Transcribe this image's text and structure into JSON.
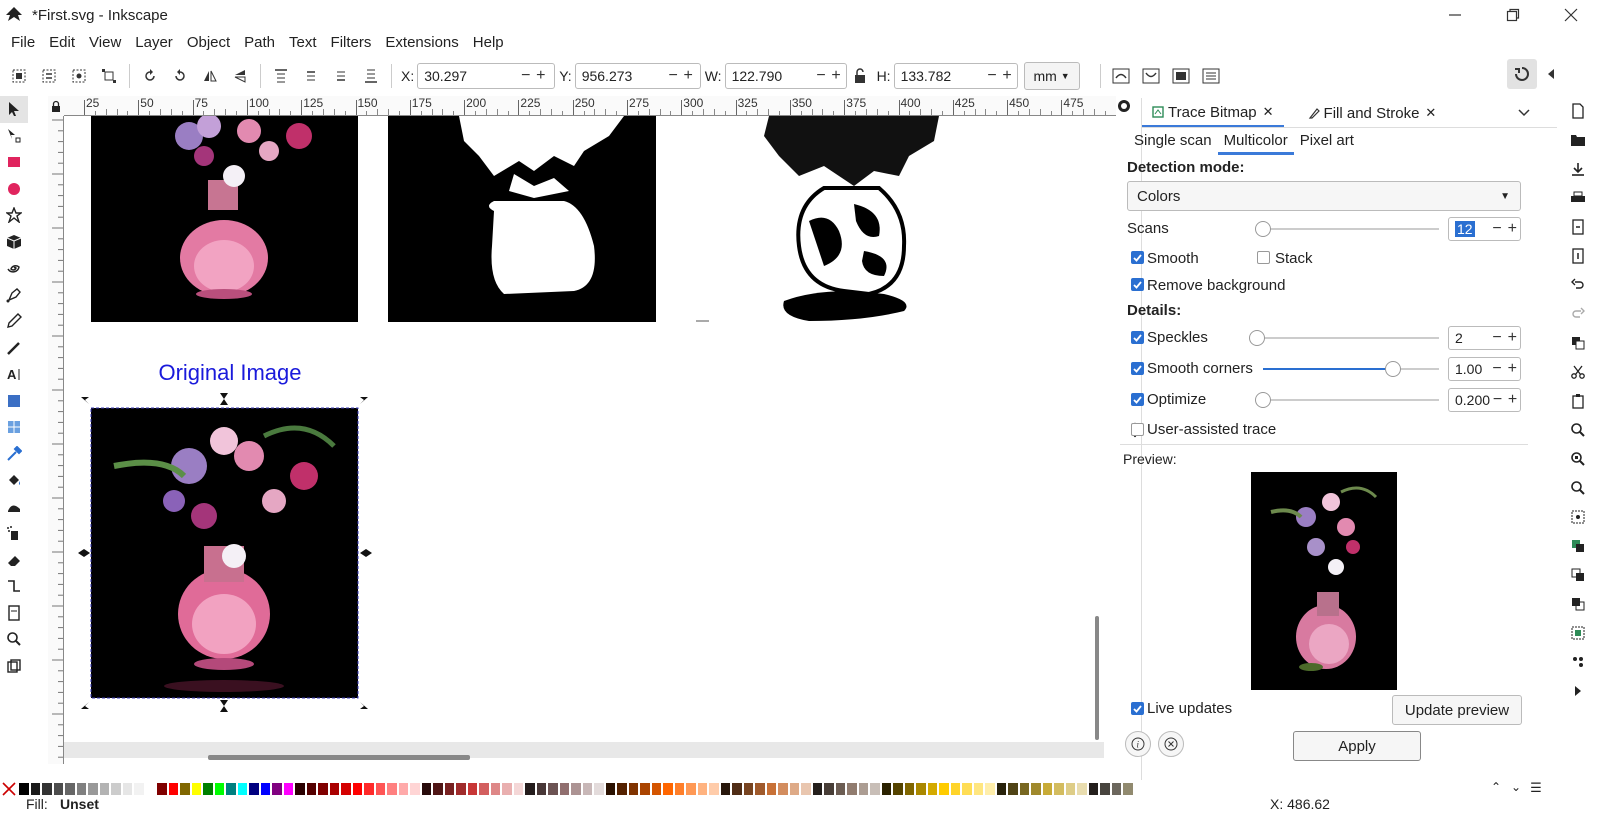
{
  "window": {
    "title": "*First.svg - Inkscape"
  },
  "menu": [
    "File",
    "Edit",
    "View",
    "Layer",
    "Object",
    "Path",
    "Text",
    "Filters",
    "Extensions",
    "Help"
  ],
  "toolbar": {
    "x_label": "X:",
    "x_value": "30.297",
    "y_label": "Y:",
    "y_value": "956.273",
    "w_label": "W:",
    "w_value": "122.790",
    "h_label": "H:",
    "h_value": "133.782",
    "unit": "mm"
  },
  "ruler": {
    "ticks": [
      "25",
      "50",
      "75",
      "100",
      "125",
      "150",
      "175",
      "200",
      "225",
      "250",
      "275",
      "300",
      "325",
      "350",
      "375",
      "400",
      "425",
      "450",
      "475"
    ]
  },
  "canvas": {
    "label": "Original Image"
  },
  "dock": {
    "tabs": [
      "Trace Bitmap",
      "Fill and Stroke"
    ],
    "subtabs": [
      "Single scan",
      "Multicolor",
      "Pixel art"
    ],
    "detection_mode_label": "Detection mode:",
    "detection_mode_value": "Colors",
    "scans_label": "Scans",
    "scans_value": "12",
    "scans_level": 0.0,
    "smooth_label": "Smooth",
    "stack_label": "Stack",
    "remove_bg_label": "Remove background",
    "details_label": "Details:",
    "speckles_label": "Speckles",
    "speckles_value": "2",
    "speckles_level": 0.0,
    "smooth_corners_label": "Smooth corners",
    "smooth_corners_value": "1.00",
    "smooth_corners_level": 0.74,
    "optimize_label": "Optimize",
    "optimize_value": "0.200",
    "optimize_level": 0.0,
    "user_assisted_label": "User-assisted trace",
    "preview_label": "Preview:",
    "live_updates_label": "Live updates",
    "update_preview_label": "Update preview",
    "apply_label": "Apply"
  },
  "status": {
    "fill_label": "Fill:",
    "fill_value": "Unset",
    "x_readout": "X: 486.62"
  },
  "colors": {
    "accent": "#2a6fd1",
    "canvas_label": "#1a1adb",
    "selection_dash": "#3a3ab8"
  }
}
